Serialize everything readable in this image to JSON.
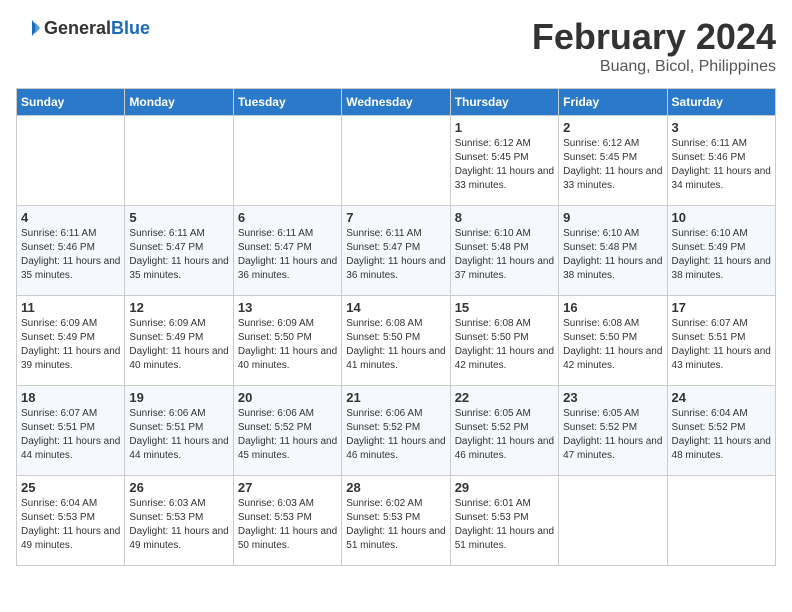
{
  "header": {
    "logo_general": "General",
    "logo_blue": "Blue",
    "month_year": "February 2024",
    "location": "Buang, Bicol, Philippines"
  },
  "weekdays": [
    "Sunday",
    "Monday",
    "Tuesday",
    "Wednesday",
    "Thursday",
    "Friday",
    "Saturday"
  ],
  "weeks": [
    [
      {
        "day": "",
        "info": ""
      },
      {
        "day": "",
        "info": ""
      },
      {
        "day": "",
        "info": ""
      },
      {
        "day": "",
        "info": ""
      },
      {
        "day": "1",
        "info": "Sunrise: 6:12 AM\nSunset: 5:45 PM\nDaylight: 11 hours and 33 minutes."
      },
      {
        "day": "2",
        "info": "Sunrise: 6:12 AM\nSunset: 5:45 PM\nDaylight: 11 hours and 33 minutes."
      },
      {
        "day": "3",
        "info": "Sunrise: 6:11 AM\nSunset: 5:46 PM\nDaylight: 11 hours and 34 minutes."
      }
    ],
    [
      {
        "day": "4",
        "info": "Sunrise: 6:11 AM\nSunset: 5:46 PM\nDaylight: 11 hours and 35 minutes."
      },
      {
        "day": "5",
        "info": "Sunrise: 6:11 AM\nSunset: 5:47 PM\nDaylight: 11 hours and 35 minutes."
      },
      {
        "day": "6",
        "info": "Sunrise: 6:11 AM\nSunset: 5:47 PM\nDaylight: 11 hours and 36 minutes."
      },
      {
        "day": "7",
        "info": "Sunrise: 6:11 AM\nSunset: 5:47 PM\nDaylight: 11 hours and 36 minutes."
      },
      {
        "day": "8",
        "info": "Sunrise: 6:10 AM\nSunset: 5:48 PM\nDaylight: 11 hours and 37 minutes."
      },
      {
        "day": "9",
        "info": "Sunrise: 6:10 AM\nSunset: 5:48 PM\nDaylight: 11 hours and 38 minutes."
      },
      {
        "day": "10",
        "info": "Sunrise: 6:10 AM\nSunset: 5:49 PM\nDaylight: 11 hours and 38 minutes."
      }
    ],
    [
      {
        "day": "11",
        "info": "Sunrise: 6:09 AM\nSunset: 5:49 PM\nDaylight: 11 hours and 39 minutes."
      },
      {
        "day": "12",
        "info": "Sunrise: 6:09 AM\nSunset: 5:49 PM\nDaylight: 11 hours and 40 minutes."
      },
      {
        "day": "13",
        "info": "Sunrise: 6:09 AM\nSunset: 5:50 PM\nDaylight: 11 hours and 40 minutes."
      },
      {
        "day": "14",
        "info": "Sunrise: 6:08 AM\nSunset: 5:50 PM\nDaylight: 11 hours and 41 minutes."
      },
      {
        "day": "15",
        "info": "Sunrise: 6:08 AM\nSunset: 5:50 PM\nDaylight: 11 hours and 42 minutes."
      },
      {
        "day": "16",
        "info": "Sunrise: 6:08 AM\nSunset: 5:50 PM\nDaylight: 11 hours and 42 minutes."
      },
      {
        "day": "17",
        "info": "Sunrise: 6:07 AM\nSunset: 5:51 PM\nDaylight: 11 hours and 43 minutes."
      }
    ],
    [
      {
        "day": "18",
        "info": "Sunrise: 6:07 AM\nSunset: 5:51 PM\nDaylight: 11 hours and 44 minutes."
      },
      {
        "day": "19",
        "info": "Sunrise: 6:06 AM\nSunset: 5:51 PM\nDaylight: 11 hours and 44 minutes."
      },
      {
        "day": "20",
        "info": "Sunrise: 6:06 AM\nSunset: 5:52 PM\nDaylight: 11 hours and 45 minutes."
      },
      {
        "day": "21",
        "info": "Sunrise: 6:06 AM\nSunset: 5:52 PM\nDaylight: 11 hours and 46 minutes."
      },
      {
        "day": "22",
        "info": "Sunrise: 6:05 AM\nSunset: 5:52 PM\nDaylight: 11 hours and 46 minutes."
      },
      {
        "day": "23",
        "info": "Sunrise: 6:05 AM\nSunset: 5:52 PM\nDaylight: 11 hours and 47 minutes."
      },
      {
        "day": "24",
        "info": "Sunrise: 6:04 AM\nSunset: 5:52 PM\nDaylight: 11 hours and 48 minutes."
      }
    ],
    [
      {
        "day": "25",
        "info": "Sunrise: 6:04 AM\nSunset: 5:53 PM\nDaylight: 11 hours and 49 minutes."
      },
      {
        "day": "26",
        "info": "Sunrise: 6:03 AM\nSunset: 5:53 PM\nDaylight: 11 hours and 49 minutes."
      },
      {
        "day": "27",
        "info": "Sunrise: 6:03 AM\nSunset: 5:53 PM\nDaylight: 11 hours and 50 minutes."
      },
      {
        "day": "28",
        "info": "Sunrise: 6:02 AM\nSunset: 5:53 PM\nDaylight: 11 hours and 51 minutes."
      },
      {
        "day": "29",
        "info": "Sunrise: 6:01 AM\nSunset: 5:53 PM\nDaylight: 11 hours and 51 minutes."
      },
      {
        "day": "",
        "info": ""
      },
      {
        "day": "",
        "info": ""
      }
    ]
  ]
}
